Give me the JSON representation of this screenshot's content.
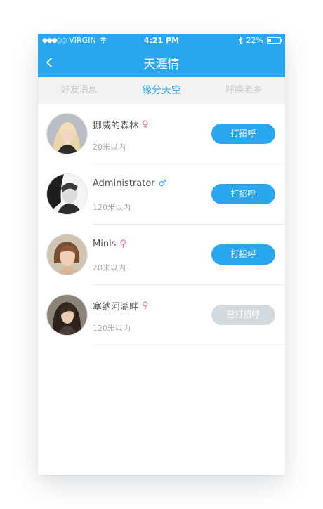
{
  "status_bar": {
    "carrier": "VIRGIN",
    "time": "4:21 PM",
    "battery_percent": "22%",
    "battery_level": 0.22
  },
  "nav": {
    "title": "天涯情",
    "back_icon": "chevron-left-icon"
  },
  "tabs": [
    {
      "label": "好友消息",
      "active": false
    },
    {
      "label": "缘分天空",
      "active": true
    },
    {
      "label": "呼唤老乡",
      "active": false
    }
  ],
  "users": [
    {
      "name": "挪威的森林",
      "gender": "♀",
      "distance": "20米以内",
      "button": "打招呼",
      "greeted": false
    },
    {
      "name": "Administrator",
      "gender": "♂",
      "distance": "120米以内",
      "button": "打招呼",
      "greeted": false
    },
    {
      "name": "Minls",
      "gender": "♀",
      "distance": "20米以内",
      "button": "打招呼",
      "greeted": false
    },
    {
      "name": "塞纳河湖畔",
      "gender": "♀",
      "distance": "120米以内",
      "button": "已打招呼",
      "greeted": true
    }
  ],
  "colors": {
    "primary": "#2aa5f0",
    "female": "#e0609a",
    "male": "#3d9be9",
    "button_done": "#d3dadf"
  }
}
